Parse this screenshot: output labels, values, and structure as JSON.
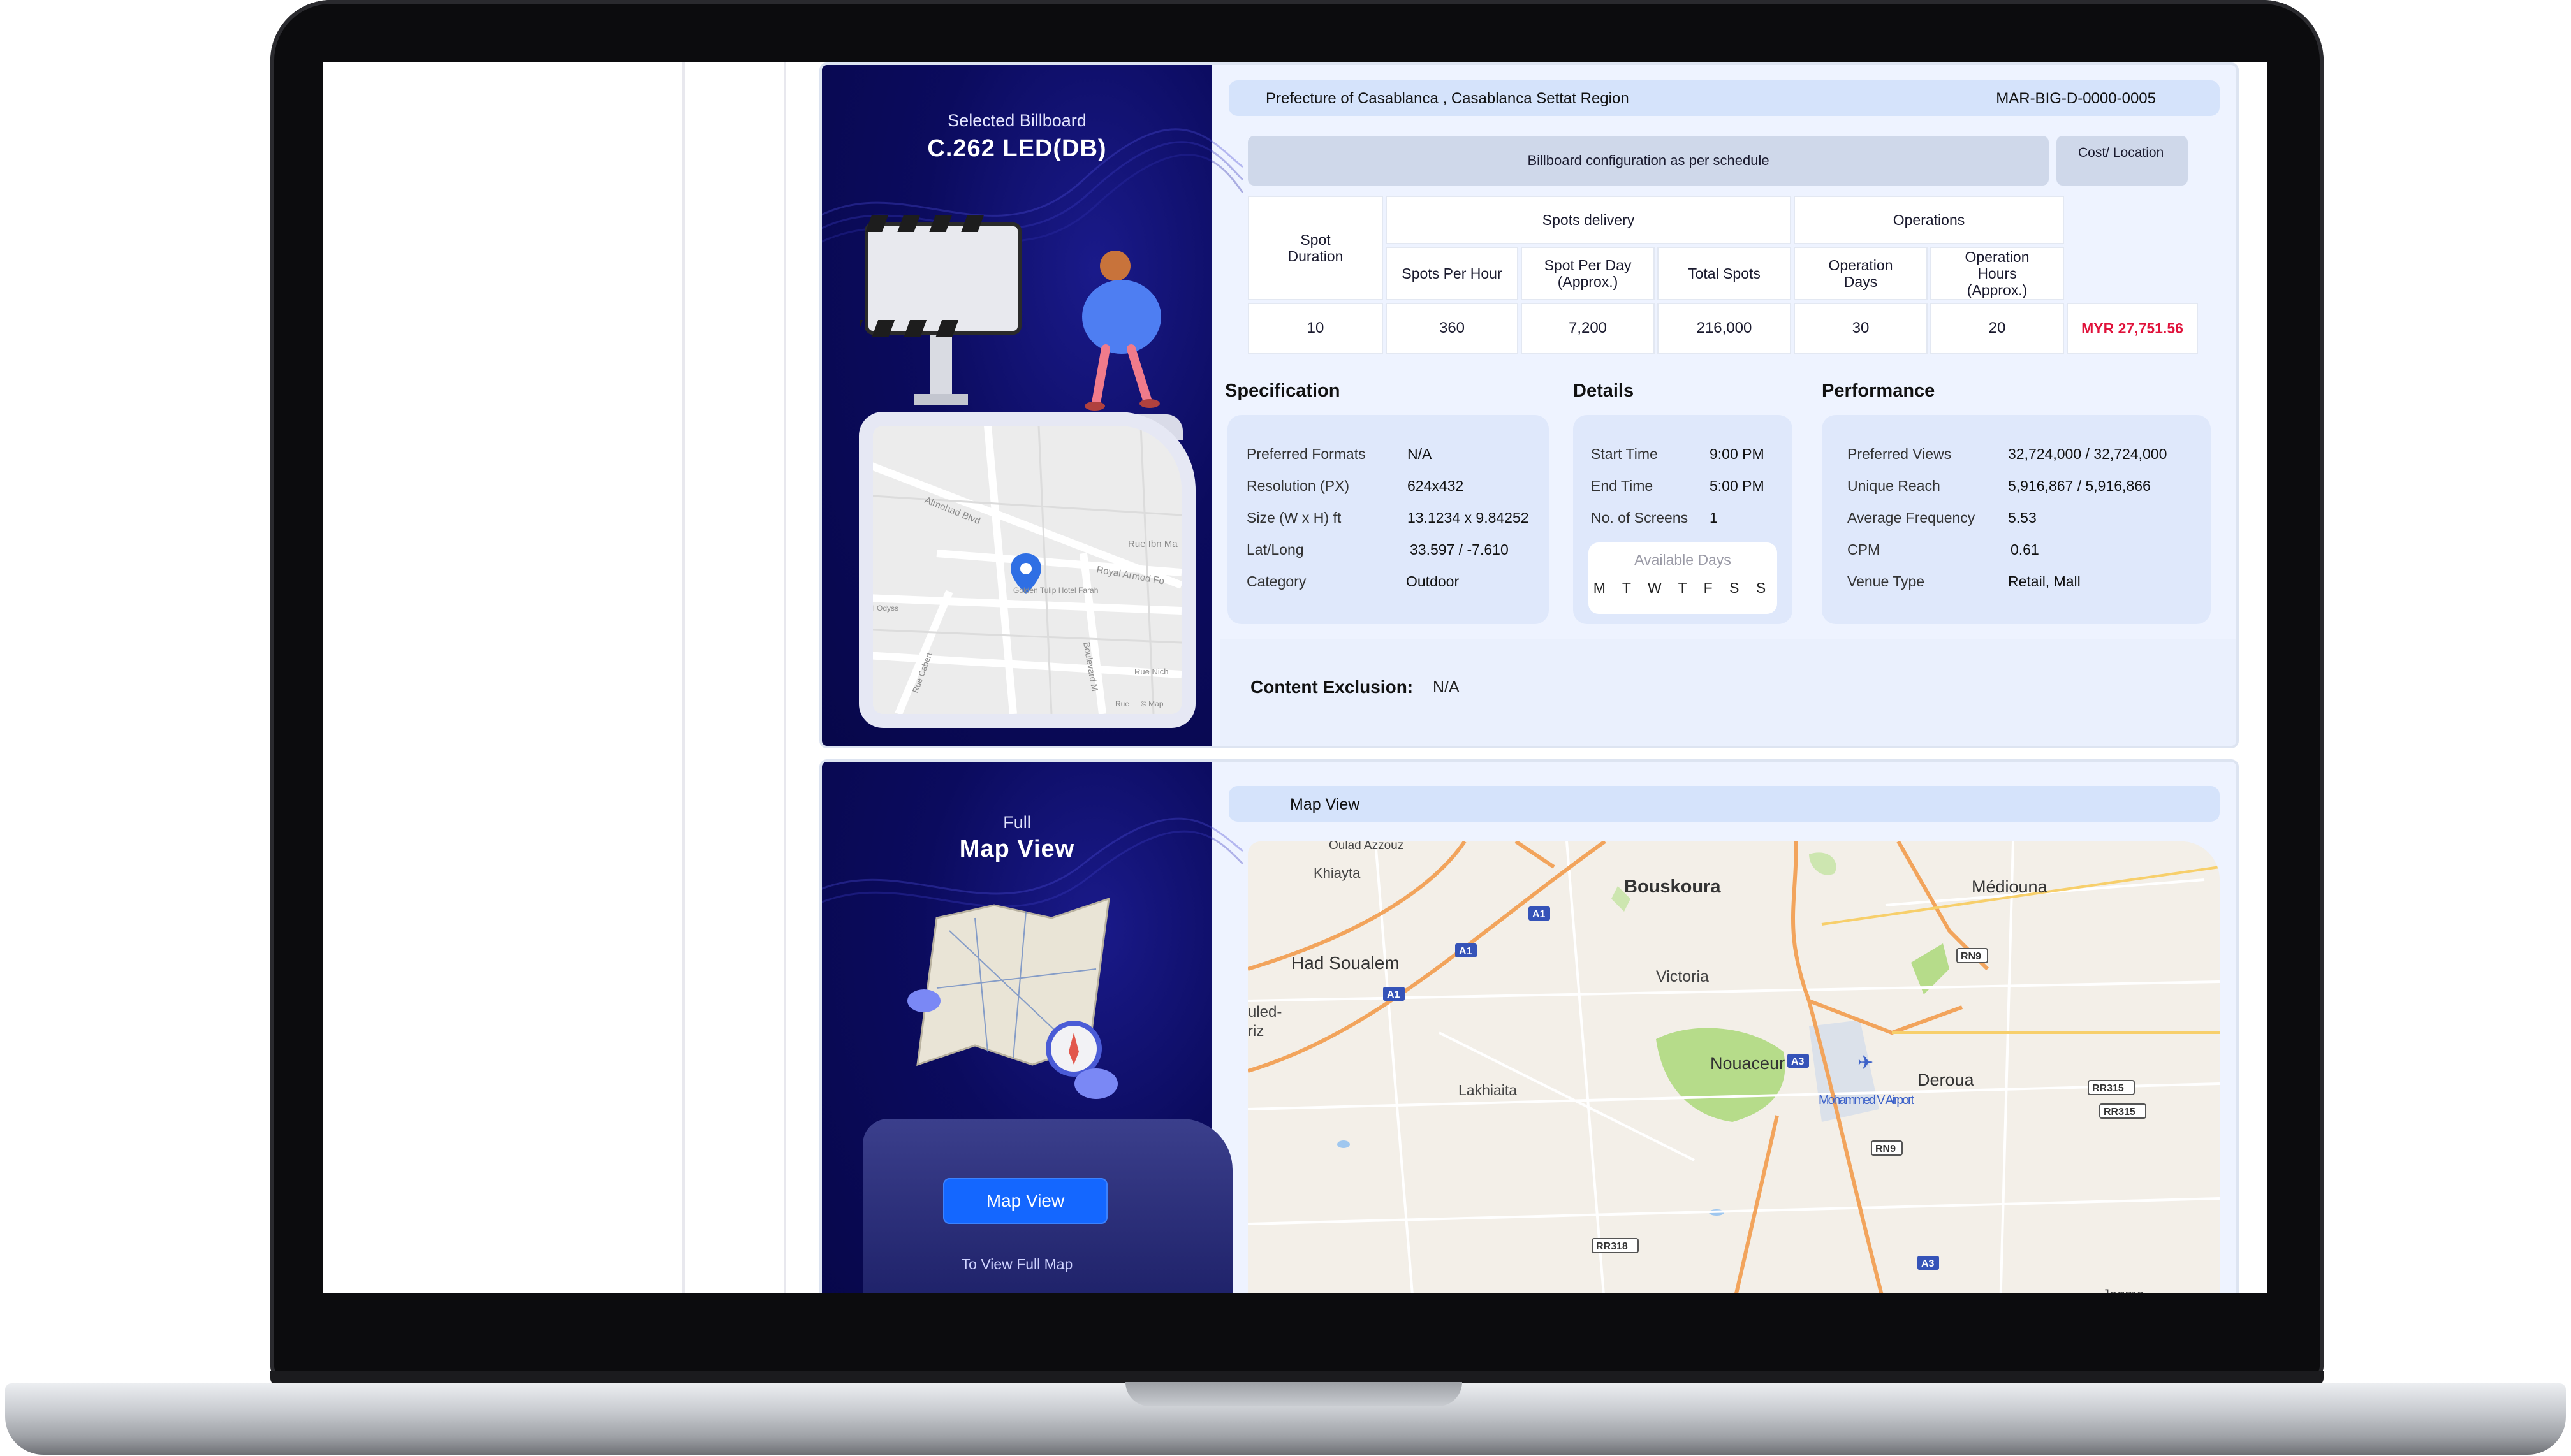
{
  "billboard": {
    "hero_kicker": "Selected Billboard",
    "hero_title": "C.262 LED(DB)",
    "location": "Prefecture of Casablanca , Casablanca Settat Region",
    "code": "MAR-BIG-D-0000-0005",
    "config_header": "Billboard configuration as per schedule",
    "cost_header": "Cost/ Location",
    "table": {
      "spot_duration_label": "Spot Duration",
      "spots_delivery_label": "Spots delivery",
      "operations_label": "Operations",
      "spots_per_hour_label": "Spots Per Hour",
      "spot_per_day_label": "Spot Per Day (Approx.)",
      "total_spots_label": "Total Spots",
      "operation_days_label": "Operation Days",
      "operation_hours_label": "Operation Hours (Approx.)",
      "spot_duration": "10",
      "spots_per_hour": "360",
      "spot_per_day": "7,200",
      "total_spots": "216,000",
      "operation_days": "30",
      "operation_hours": "20",
      "cost": "MYR 27,751.56"
    },
    "specification": {
      "title": "Specification",
      "rows": [
        {
          "label": "Preferred Formats",
          "value": "N/A"
        },
        {
          "label": "Resolution (PX)",
          "value": "624x432"
        },
        {
          "label": "Size (W x H) ft",
          "value": "13.1234 x 9.84252"
        },
        {
          "label": "Lat/Long",
          "value": "33.597 / -7.610"
        },
        {
          "label": "Category",
          "value": "Outdoor"
        }
      ]
    },
    "details": {
      "title": "Details",
      "rows": [
        {
          "label": "Start Time",
          "value": "9:00 PM"
        },
        {
          "label": "End Time",
          "value": "5:00 PM"
        },
        {
          "label": "No. of Screens",
          "value": "1"
        }
      ],
      "available_days_title": "Available Days",
      "available_days": "M T W T F S S"
    },
    "performance": {
      "title": "Performance",
      "rows": [
        {
          "label": "Preferred Views",
          "value": "32,724,000 / 32,724,000"
        },
        {
          "label": "Unique Reach",
          "value": "5,916,867 / 5,916,866"
        },
        {
          "label": "Average Frequency",
          "value": "5.53"
        },
        {
          "label": "CPM",
          "value": "0.61"
        },
        {
          "label": "Venue Type",
          "value": "Retail, Mall"
        }
      ]
    },
    "content_exclusion_label": "Content Exclusion:",
    "content_exclusion_value": "N/A",
    "mini_map": {
      "labels": [
        "Almohad Blvd",
        "Rue Ibn Ma",
        "Royal Armed Fo",
        "Golden Tulip Hotel Farah",
        "l Odyss",
        "Rue Cabert",
        "Boulevard M",
        "Rue Nich",
        "Rue",
        "© Map"
      ]
    }
  },
  "map_section": {
    "hero_kicker": "Full",
    "hero_title": "Map View",
    "bar_label": "Map View",
    "button_label": "Map View",
    "button_sub": "To View Full Map",
    "places": {
      "oulad_azzouz": "Oulad Azzouz",
      "khiayta": "Khiayta",
      "bouskoura": "Bouskoura",
      "mediouna": "Médiouna",
      "had_soualem": "Had Soualem",
      "victoria": "Victoria",
      "nouaceur": "Nouaceur",
      "deroua": "Deroua",
      "airport": "Mohammed V Airport",
      "lakhiaita": "Lakhiaita",
      "jaqma": "Jaqma",
      "uled": "uled-",
      "riz": "riz"
    },
    "road_badges": {
      "a1_1": "A1",
      "a1_2": "A1",
      "a1_3": "A1",
      "a3_1": "A3",
      "a3_2": "A3",
      "rn9_1": "RN9",
      "rn9_2": "RN9",
      "rr315_1": "RR315",
      "rr315_2": "RR315",
      "rr318": "RR318"
    }
  }
}
